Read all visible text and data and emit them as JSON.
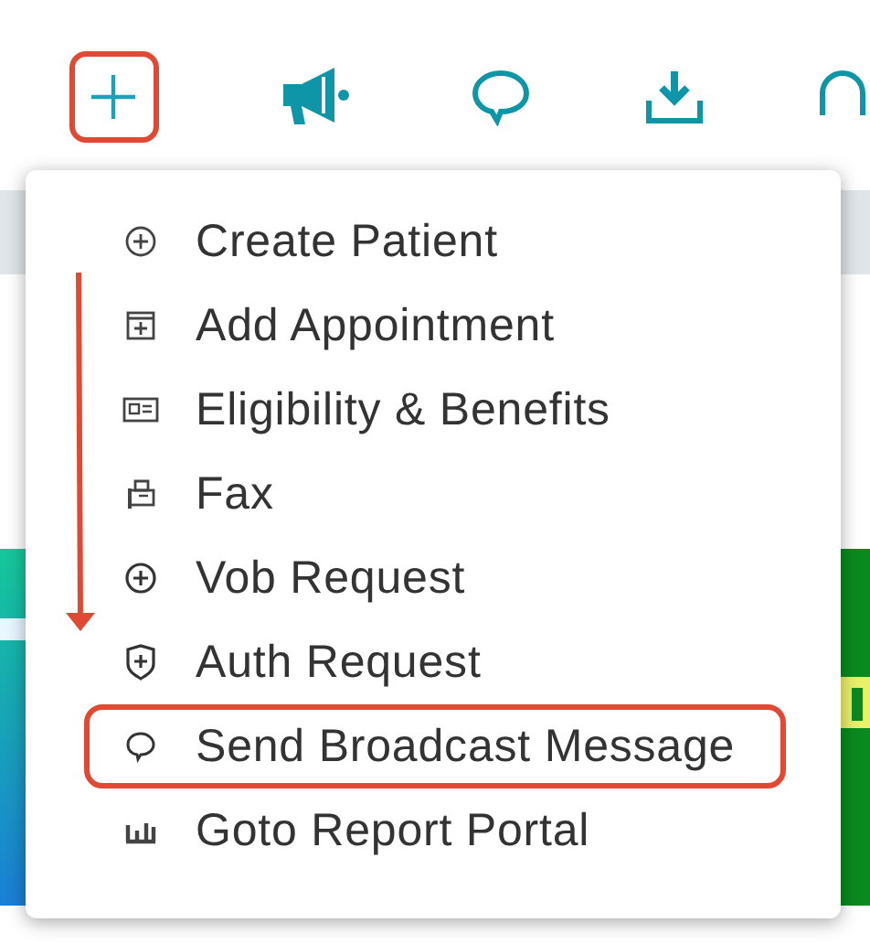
{
  "toolbar": {
    "add_button_annotated": true
  },
  "menu": {
    "items": [
      {
        "label": "Create Patient",
        "annotated": false
      },
      {
        "label": "Add Appointment",
        "annotated": false
      },
      {
        "label": "Eligibility & Benefits",
        "annotated": false
      },
      {
        "label": "Fax",
        "annotated": false
      },
      {
        "label": "Vob Request",
        "annotated": false
      },
      {
        "label": "Auth Request",
        "annotated": false
      },
      {
        "label": "Send Broadcast Message",
        "annotated": true
      },
      {
        "label": "Goto Report Portal",
        "annotated": false
      }
    ]
  }
}
